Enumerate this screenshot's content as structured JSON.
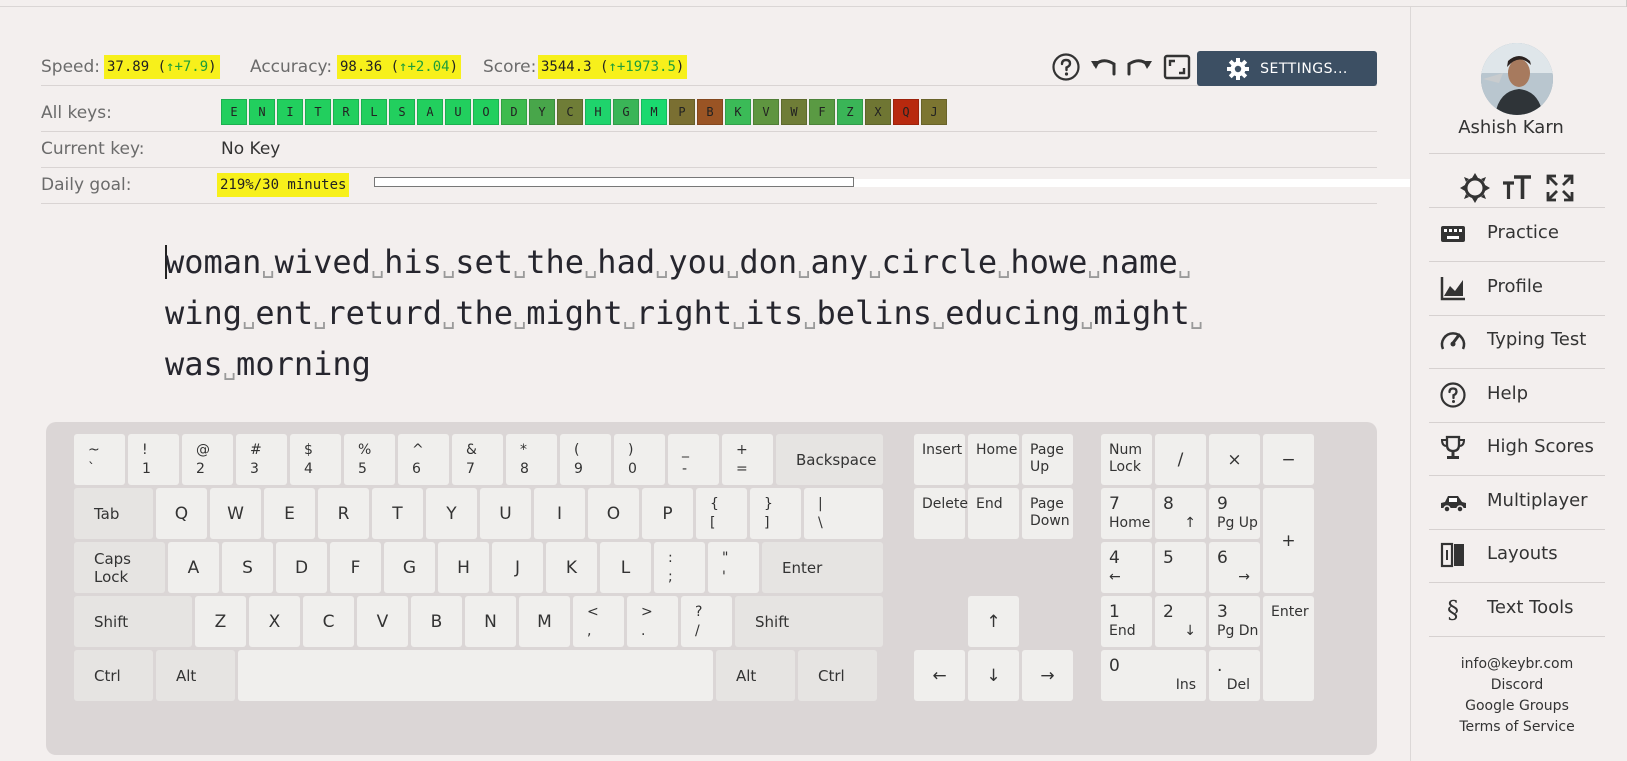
{
  "stats": {
    "speed": {
      "label": "Speed:",
      "value": "37.89",
      "delta": "↑+7.9"
    },
    "accuracy": {
      "label": "Accuracy:",
      "value": "98.36",
      "delta": "↑+2.04"
    },
    "score": {
      "label": "Score:",
      "value": "3544.3",
      "delta": "↑+1973.5"
    },
    "all_keys_label": "All keys:",
    "current_key_label": "Current key:",
    "current_key_value": "No Key",
    "daily_goal_label": "Daily goal:",
    "daily_goal_value": "219%/30 minutes",
    "daily_goal_progress": 1.0
  },
  "all_keys": [
    {
      "k": "E",
      "color": "#22cf5e"
    },
    {
      "k": "N",
      "color": "#22cf5e"
    },
    {
      "k": "I",
      "color": "#22cf5e"
    },
    {
      "k": "T",
      "color": "#22cf5e"
    },
    {
      "k": "R",
      "color": "#22cf5e"
    },
    {
      "k": "L",
      "color": "#22cf5e"
    },
    {
      "k": "S",
      "color": "#22cf5e"
    },
    {
      "k": "A",
      "color": "#22cf5e"
    },
    {
      "k": "U",
      "color": "#22cf5e"
    },
    {
      "k": "O",
      "color": "#22cf5e"
    },
    {
      "k": "D",
      "color": "#3dbb4e"
    },
    {
      "k": "Y",
      "color": "#48a64a"
    },
    {
      "k": "C",
      "color": "#6f7d37"
    },
    {
      "k": "H",
      "color": "#1fd46c"
    },
    {
      "k": "G",
      "color": "#3ab557"
    },
    {
      "k": "M",
      "color": "#1ad96f"
    },
    {
      "k": "P",
      "color": "#7a6f32"
    },
    {
      "k": "B",
      "color": "#9a5424"
    },
    {
      "k": "K",
      "color": "#3bbb57"
    },
    {
      "k": "V",
      "color": "#5f9540"
    },
    {
      "k": "W",
      "color": "#6f7d37"
    },
    {
      "k": "F",
      "color": "#5a9a43"
    },
    {
      "k": "Z",
      "color": "#3ab557"
    },
    {
      "k": "X",
      "color": "#6f7633"
    },
    {
      "k": "Q",
      "color": "#b8290e"
    },
    {
      "k": "J",
      "color": "#7c7531"
    }
  ],
  "toolbar": {
    "settings_label": "SETTINGS..."
  },
  "practice_lines": [
    [
      "woman",
      "wived",
      "his",
      "set",
      "the",
      "had",
      "you",
      "don",
      "any",
      "circle",
      "howe",
      "name",
      ""
    ],
    [
      "wing",
      "ent",
      "returd",
      "the",
      "might",
      "right",
      "its",
      "belins",
      "educing",
      "might",
      ""
    ],
    [
      "was",
      "morning"
    ]
  ],
  "space_glyph": "␣",
  "keyboard": {
    "rows": [
      [
        {
          "top": "~",
          "bottom": "`"
        },
        {
          "top": "!",
          "bottom": "1"
        },
        {
          "top": "@",
          "bottom": "2"
        },
        {
          "top": "#",
          "bottom": "3"
        },
        {
          "top": "$",
          "bottom": "4"
        },
        {
          "top": "%",
          "bottom": "5"
        },
        {
          "top": "^",
          "bottom": "6"
        },
        {
          "top": "&",
          "bottom": "7"
        },
        {
          "top": "*",
          "bottom": "8"
        },
        {
          "top": "(",
          "bottom": "9"
        },
        {
          "top": ")",
          "bottom": "0"
        },
        {
          "top": "_",
          "bottom": "-"
        },
        {
          "top": "+",
          "bottom": "="
        },
        {
          "label": "Backspace"
        }
      ],
      [
        {
          "label": "Tab"
        },
        {
          "center": "Q"
        },
        {
          "center": "W"
        },
        {
          "center": "E"
        },
        {
          "center": "R"
        },
        {
          "center": "T"
        },
        {
          "center": "Y"
        },
        {
          "center": "U"
        },
        {
          "center": "I"
        },
        {
          "center": "O"
        },
        {
          "center": "P"
        },
        {
          "top": "{",
          "bottom": "["
        },
        {
          "top": "}",
          "bottom": "]"
        },
        {
          "top": "|",
          "bottom": "\\"
        }
      ],
      [
        {
          "label": "Caps Lock"
        },
        {
          "center": "A"
        },
        {
          "center": "S"
        },
        {
          "center": "D"
        },
        {
          "center": "F"
        },
        {
          "center": "G"
        },
        {
          "center": "H"
        },
        {
          "center": "J"
        },
        {
          "center": "K"
        },
        {
          "center": "L"
        },
        {
          "top": ":",
          "bottom": ";"
        },
        {
          "top": "\"",
          "bottom": "'"
        },
        {
          "label": "Enter"
        }
      ],
      [
        {
          "label": "Shift"
        },
        {
          "center": "Z"
        },
        {
          "center": "X"
        },
        {
          "center": "C"
        },
        {
          "center": "V"
        },
        {
          "center": "B"
        },
        {
          "center": "N"
        },
        {
          "center": "M"
        },
        {
          "top": "<",
          "bottom": ","
        },
        {
          "top": ">",
          "bottom": "."
        },
        {
          "top": "?",
          "bottom": "/"
        },
        {
          "label": "Shift"
        }
      ],
      [
        {
          "label": "Ctrl"
        },
        {
          "label": "Alt"
        },
        {
          "label": ""
        },
        {
          "label": "Alt"
        },
        {
          "label": "Ctrl"
        }
      ]
    ],
    "nav": [
      {
        "top": "Insert"
      },
      {
        "top": "Home"
      },
      {
        "top": "Page\nUp"
      },
      {
        "top": "Delete"
      },
      {
        "top": "End"
      },
      {
        "top": "Page\nDown"
      }
    ],
    "arrows": {
      "up": "↑",
      "left": "←",
      "down": "↓",
      "right": "→"
    },
    "numpad": [
      {
        "top": "Num\nLock"
      },
      {
        "center": "/"
      },
      {
        "center": "×"
      },
      {
        "center": "−"
      },
      {
        "top": "7",
        "bl": "Home"
      },
      {
        "top": "8",
        "br": "↑"
      },
      {
        "top": "9",
        "bl": "Pg Up"
      },
      {
        "center": "+"
      },
      {
        "top": "4",
        "bl": "←"
      },
      {
        "top": "5"
      },
      {
        "top": "6",
        "br": "→"
      },
      {
        "top": "1",
        "bl": "End"
      },
      {
        "top": "2",
        "br": "↓"
      },
      {
        "top": "3",
        "bl": "Pg Dn"
      },
      {
        "top": "Enter"
      },
      {
        "top": "0",
        "br": "Ins"
      },
      {
        "top": ".",
        "br": "Del"
      }
    ]
  },
  "sidebar": {
    "username": "Ashish Karn",
    "nav": [
      {
        "label": "Practice",
        "icon": "keyboard-icon"
      },
      {
        "label": "Profile",
        "icon": "chart-icon"
      },
      {
        "label": "Typing Test",
        "icon": "speedometer-icon"
      },
      {
        "label": "Help",
        "icon": "help-icon"
      },
      {
        "label": "High Scores",
        "icon": "trophy-icon"
      },
      {
        "label": "Multiplayer",
        "icon": "car-icon"
      },
      {
        "label": "Layouts",
        "icon": "layouts-icon"
      },
      {
        "label": "Text Tools",
        "icon": "section-icon"
      }
    ],
    "footer": [
      "info@keybr.com",
      "Discord",
      "Google Groups",
      "Terms of Service"
    ]
  }
}
